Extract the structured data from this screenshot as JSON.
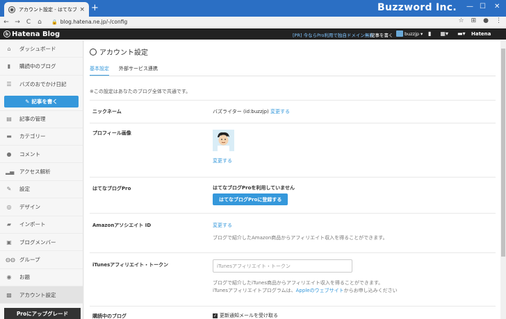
{
  "browser": {
    "tab_title": "アカウント設定 - はてなブログ",
    "tab_close": "×",
    "new_tab": "+",
    "brand": "Buzzword Inc.",
    "url": "blog.hatena.ne.jp/-/config",
    "back": "←",
    "forward": "→",
    "reload": "C",
    "home": "⌂"
  },
  "hatena_bar": {
    "logo": "Hatena Blog",
    "promo": "[PR] 今ならPro利用で独自ドメイン無料",
    "write": "記事を書く",
    "user": "buzzjp",
    "hatena": "Hatena"
  },
  "sidebar": {
    "items": [
      {
        "label": "ダッシュボード",
        "icon": "home-icon"
      },
      {
        "label": "購読中のブログ",
        "icon": "bookmark-icon"
      },
      {
        "label": "バズのおでかけ日記",
        "icon": "blog-icon"
      }
    ],
    "write_button": "記事を書く",
    "menu": [
      {
        "label": "記事の管理",
        "icon": "document-icon"
      },
      {
        "label": "カテゴリー",
        "icon": "folder-icon"
      },
      {
        "label": "コメント",
        "icon": "comment-icon"
      },
      {
        "label": "アクセス解析",
        "icon": "bar-chart-icon"
      },
      {
        "label": "設定",
        "icon": "wrench-icon"
      },
      {
        "label": "デザイン",
        "icon": "palette-icon"
      },
      {
        "label": "インポート",
        "icon": "truck-icon"
      },
      {
        "label": "ブログメンバー",
        "icon": "members-icon"
      },
      {
        "label": "グループ",
        "icon": "group-icon"
      },
      {
        "label": "お題",
        "icon": "topic-icon"
      },
      {
        "label": "アカウント設定",
        "icon": "account-icon"
      }
    ],
    "pro_button": "Proにアップグレード"
  },
  "main": {
    "title": "アカウント設定",
    "tabs": [
      "基本設定",
      "外部サービス連携"
    ],
    "note": "※この設定はあなたのブログ全体で共通です。",
    "nickname": {
      "label": "ニックネーム",
      "value": "バズライター (id:buzzjp)",
      "link": "変更する"
    },
    "profile_image": {
      "label": "プロフィール画像",
      "link": "変更する"
    },
    "hatena_pro": {
      "label": "はてなブログPro",
      "status": "はてなブログProを利用していません",
      "button": "はてなブログProに登録する"
    },
    "amazon": {
      "label": "Amazonアソシエイト ID",
      "link": "変更する",
      "desc": "ブログで紹介したAmazon商品からアフィリエイト収入を得ることができます。"
    },
    "itunes": {
      "label": "iTunesアフィリエイト・トークン",
      "placeholder": "iTunesアフィリエイト・トークン",
      "desc1": "ブログで紹介したiTunes商品からアフィリエイト収入を得ることができます。",
      "desc2_pre": "iTunesアフィリエイトプログラムは、",
      "desc2_link": "Appleのウェブサイト",
      "desc2_post": "からお申し込みください"
    },
    "subscribed": {
      "label": "購読中のブログ",
      "checkbox": "更新通知メールを受け取る"
    }
  }
}
